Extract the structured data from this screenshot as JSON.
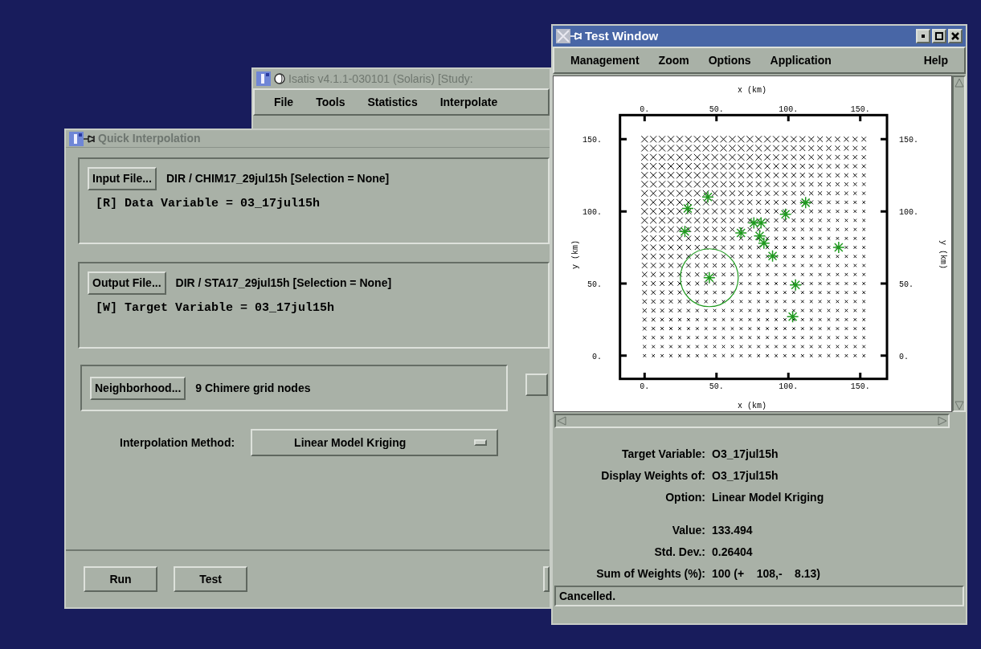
{
  "isatis_window": {
    "title": "Isatis v4.1.1-030101 (Solaris) [Study:",
    "menu": [
      "File",
      "Tools",
      "Statistics",
      "Interpolate"
    ]
  },
  "quick_interpolation": {
    "title": "Quick Interpolation",
    "input": {
      "button": "Input File...",
      "file": "DIR / CHIM17_29jul15h [Selection = None]",
      "variable": "[R] Data Variable = 03_17jul15h"
    },
    "output": {
      "button": "Output File...",
      "file": "DIR / STA17_29jul15h [Selection = None]",
      "variable": "[W] Target Variable = 03_17jul15h"
    },
    "neighborhood": {
      "button": "Neighborhood...",
      "value": "9 Chimere grid nodes"
    },
    "method": {
      "label": "Interpolation Method:",
      "value": "Linear Model Kriging"
    },
    "buttons": [
      "Run",
      "Test"
    ]
  },
  "test_window": {
    "title": "Test Window",
    "menu": [
      "Management",
      "Zoom",
      "Options",
      "Application"
    ],
    "help": "Help",
    "plot": {
      "xlabel_top": "x (km)",
      "ylabel_right": "y (km)",
      "chart_data": {
        "type": "scatter",
        "xlabel": "x (km)",
        "ylabel": "y (km)",
        "xlim": [
          -17.1,
          168.6
        ],
        "ylim": [
          -16.1,
          166.7
        ],
        "xticks": [
          {
            "value": 0,
            "label": "0."
          },
          {
            "value": 50,
            "label": "50."
          },
          {
            "value": 100,
            "label": "100."
          },
          {
            "value": 150,
            "label": "150."
          }
        ],
        "yticks": [
          {
            "value": 0,
            "label": "0."
          },
          {
            "value": 50,
            "label": "50."
          },
          {
            "value": 100,
            "label": "100."
          },
          {
            "value": 150,
            "label": "150."
          }
        ],
        "x": [
          44,
          30,
          28,
          67,
          76,
          81,
          80,
          83,
          89,
          98,
          112,
          135,
          45,
          105,
          103
        ],
        "series": [
          {
            "color": "#1f9a1f",
            "values": [
              110,
              102,
              86,
              85,
              92,
              92,
              83,
              78,
              69,
              98,
              106,
              75,
              54,
              49,
              27
            ]
          }
        ]
      }
    },
    "info": [
      {
        "label": "Target Variable:",
        "value": "O3_17jul15h"
      },
      {
        "label": "Display Weights of:",
        "value": "O3_17jul15h"
      },
      {
        "label": "Option:",
        "value": "Linear Model Kriging"
      }
    ],
    "results": [
      {
        "label": "Value:",
        "value": "133.494"
      },
      {
        "label": "Std. Dev.:",
        "value": "0.26404"
      },
      {
        "label": "Sum of Weights (%):",
        "value": "100 (+    108,-    8.13)"
      }
    ],
    "status": "Cancelled."
  }
}
